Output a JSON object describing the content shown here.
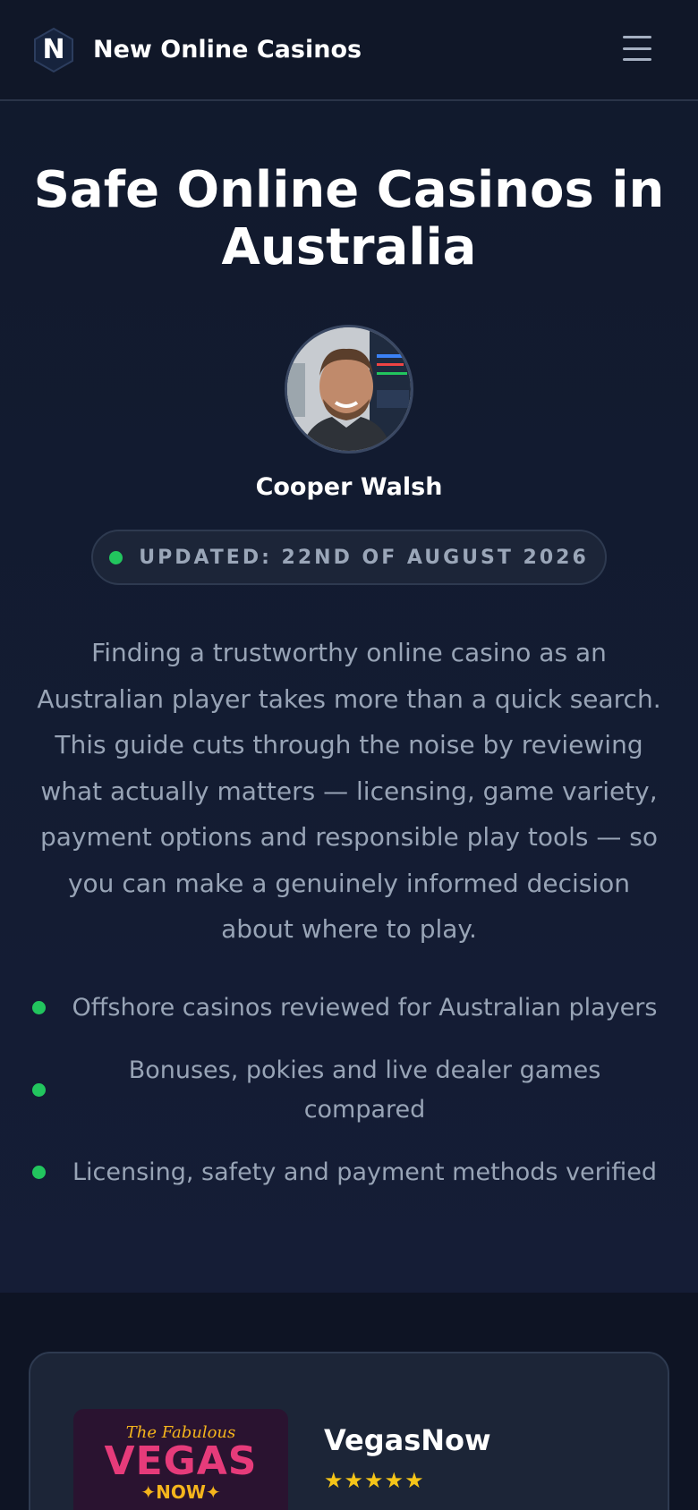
{
  "header": {
    "logo_letter": "N",
    "brand_name": "New Online Casinos",
    "menu_icon": "hamburger-menu-icon"
  },
  "hero": {
    "title": "Safe Online Casinos in Australia",
    "author_name": "Cooper Walsh",
    "updated_label": "UPDATED: 22ND OF AUGUST 2026",
    "intro": "Finding a trustworthy online casino as an Australian player takes more than a quick search. This guide cuts through the noise by reviewing what actually matters — licensing, game variety, payment options and responsible play tools — so you can make a genuinely informed decision about where to play.",
    "bullets": [
      "Offshore casinos reviewed for Australian players",
      "Bonuses, pokies and live dealer games compared",
      "Licensing, safety and payment methods verified"
    ]
  },
  "listing": {
    "casinos": [
      {
        "logo_sub": "The Fabulous",
        "logo_main": "VEGAS",
        "logo_now": "✦NOW✦",
        "name": "VegasNow",
        "rating": 5,
        "stars": "★★★★★"
      }
    ]
  },
  "colors": {
    "background": "#0f1629",
    "accent_green": "#22c55e",
    "star_gold": "#f5c518",
    "text_muted": "#98a4b6"
  }
}
